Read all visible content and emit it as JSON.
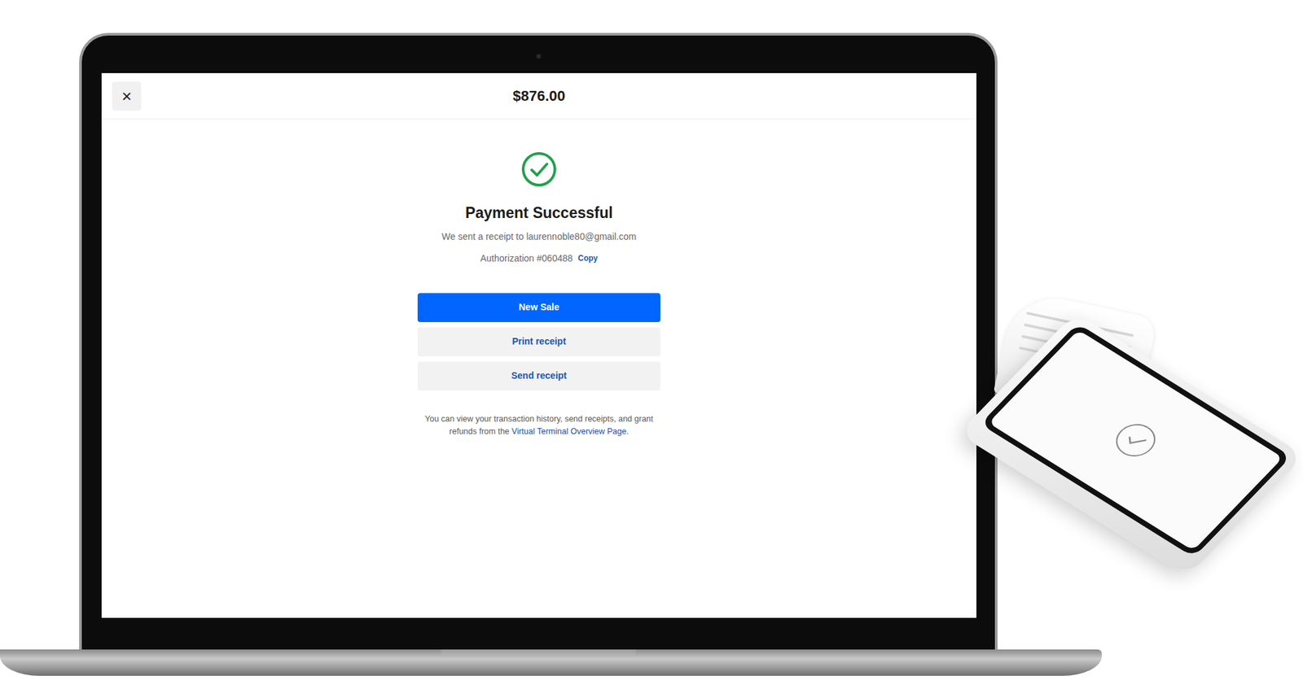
{
  "dialog": {
    "close": "×",
    "amount": "$876.00",
    "status": "Payment Successful",
    "receipt_note": "We sent a receipt to laurennoble80@gmail.com",
    "authorization": "Authorization #060488",
    "copy": "Copy",
    "buttons": [
      {
        "label": "New Sale",
        "kind": "primary"
      },
      {
        "label": "Print receipt",
        "kind": "secondary"
      },
      {
        "label": "Send receipt",
        "kind": "secondary"
      }
    ],
    "footer": {
      "text": "You can view your transaction history, send receipts, and grant refunds from the ",
      "link": "Virtual Terminal Overview Page",
      "end": "."
    }
  }
}
